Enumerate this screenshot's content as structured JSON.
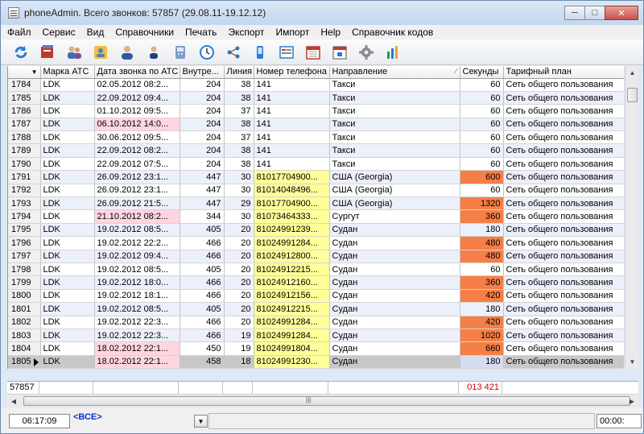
{
  "window": {
    "title": "phoneAdmin. Всего звонков: 57857 (29.08.11-19.12.12)"
  },
  "menu": [
    "Файл",
    "Сервис",
    "Вид",
    "Справочники",
    "Печать",
    "Экспорт",
    "Импорт",
    "Help",
    "Справочник кодов"
  ],
  "toolbar": [
    "refresh-icon",
    "stack-icon",
    "users-icon",
    "contacts-icon",
    "user-icon",
    "person-icon",
    "phone-icon",
    "clock-icon",
    "network-icon",
    "mobile-icon",
    "form-icon",
    "calendar-month-icon",
    "calendar-day-icon",
    "gear-icon",
    "chart-icon"
  ],
  "columns": [
    "",
    "Марка АТС",
    "Дата звонка по АТС",
    "Внутре...",
    "Линия",
    "Номер телефона",
    "Направление",
    "Секунды",
    "Тарифный план"
  ],
  "rows": [
    {
      "id": "1784",
      "ats": "LDK",
      "date": "02.05.2012 08:2...",
      "ext": "204",
      "line": "38",
      "phone": "141",
      "dir": "Такси",
      "sec": "60",
      "plan": "Сеть общего пользования"
    },
    {
      "id": "1785",
      "ats": "LDK",
      "date": "22.09.2012 09:4...",
      "ext": "204",
      "line": "38",
      "phone": "141",
      "dir": "Такси",
      "sec": "60",
      "plan": "Сеть общего пользования"
    },
    {
      "id": "1786",
      "ats": "LDK",
      "date": "01.10.2012 09:5...",
      "ext": "204",
      "line": "37",
      "phone": "141",
      "dir": "Такси",
      "sec": "60",
      "plan": "Сеть общего пользования"
    },
    {
      "id": "1787",
      "ats": "LDK",
      "date": "06.10.2012 14:0...",
      "ext": "204",
      "line": "38",
      "phone": "141",
      "dir": "Такси",
      "sec": "60",
      "plan": "Сеть общего пользования",
      "date_hl": "pink"
    },
    {
      "id": "1788",
      "ats": "LDK",
      "date": "30.06.2012 09:5...",
      "ext": "204",
      "line": "37",
      "phone": "141",
      "dir": "Такси",
      "sec": "60",
      "plan": "Сеть общего пользования"
    },
    {
      "id": "1789",
      "ats": "LDK",
      "date": "22.09.2012 08:2...",
      "ext": "204",
      "line": "38",
      "phone": "141",
      "dir": "Такси",
      "sec": "60",
      "plan": "Сеть общего пользования"
    },
    {
      "id": "1790",
      "ats": "LDK",
      "date": "22.09.2012 07:5...",
      "ext": "204",
      "line": "38",
      "phone": "141",
      "dir": "Такси",
      "sec": "60",
      "plan": "Сеть общего пользования"
    },
    {
      "id": "1791",
      "ats": "LDK",
      "date": "26.09.2012 23:1...",
      "ext": "447",
      "line": "30",
      "phone": "81017704900...",
      "dir": "США (Georgia)",
      "sec": "600",
      "plan": "Сеть общего пользования",
      "phone_hl": "yellow",
      "sec_hl": "orange"
    },
    {
      "id": "1792",
      "ats": "LDK",
      "date": "26.09.2012 23:1...",
      "ext": "447",
      "line": "30",
      "phone": "81014048496...",
      "dir": "США (Georgia)",
      "sec": "60",
      "plan": "Сеть общего пользования",
      "phone_hl": "yellow"
    },
    {
      "id": "1793",
      "ats": "LDK",
      "date": "26.09.2012 21:5...",
      "ext": "447",
      "line": "29",
      "phone": "81017704900...",
      "dir": "США (Georgia)",
      "sec": "1320",
      "plan": "Сеть общего пользования",
      "phone_hl": "yellow",
      "sec_hl": "orange"
    },
    {
      "id": "1794",
      "ats": "LDK",
      "date": "21.10.2012 08:2...",
      "ext": "344",
      "line": "30",
      "phone": "81073464333...",
      "dir": "Сургут",
      "sec": "360",
      "plan": "Сеть общего пользования",
      "date_hl": "pink",
      "phone_hl": "yellow",
      "sec_hl": "orange"
    },
    {
      "id": "1795",
      "ats": "LDK",
      "date": "19.02.2012 08:5...",
      "ext": "405",
      "line": "20",
      "phone": "81024991239...",
      "dir": "Судан",
      "sec": "180",
      "plan": "Сеть общего пользования",
      "phone_hl": "yellow"
    },
    {
      "id": "1796",
      "ats": "LDK",
      "date": "19.02.2012 22:2...",
      "ext": "466",
      "line": "20",
      "phone": "81024991284...",
      "dir": "Судан",
      "sec": "480",
      "plan": "Сеть общего пользования",
      "phone_hl": "yellow",
      "sec_hl": "orange"
    },
    {
      "id": "1797",
      "ats": "LDK",
      "date": "19.02.2012 09:4...",
      "ext": "466",
      "line": "20",
      "phone": "81024912800...",
      "dir": "Судан",
      "sec": "480",
      "plan": "Сеть общего пользования",
      "phone_hl": "yellow",
      "sec_hl": "orange"
    },
    {
      "id": "1798",
      "ats": "LDK",
      "date": "19.02.2012 08:5...",
      "ext": "405",
      "line": "20",
      "phone": "81024912215...",
      "dir": "Судан",
      "sec": "60",
      "plan": "Сеть общего пользования",
      "phone_hl": "yellow"
    },
    {
      "id": "1799",
      "ats": "LDK",
      "date": "19.02.2012 18:0...",
      "ext": "466",
      "line": "20",
      "phone": "81024912160...",
      "dir": "Судан",
      "sec": "360",
      "plan": "Сеть общего пользования",
      "phone_hl": "yellow",
      "sec_hl": "orange"
    },
    {
      "id": "1800",
      "ats": "LDK",
      "date": "19.02.2012 18:1...",
      "ext": "466",
      "line": "20",
      "phone": "81024912156...",
      "dir": "Судан",
      "sec": "420",
      "plan": "Сеть общего пользования",
      "phone_hl": "yellow",
      "sec_hl": "orange"
    },
    {
      "id": "1801",
      "ats": "LDK",
      "date": "19.02.2012 08:5...",
      "ext": "405",
      "line": "20",
      "phone": "81024912215...",
      "dir": "Судан",
      "sec": "180",
      "plan": "Сеть общего пользования",
      "phone_hl": "yellow"
    },
    {
      "id": "1802",
      "ats": "LDK",
      "date": "19.02.2012 22:3...",
      "ext": "466",
      "line": "20",
      "phone": "81024991284...",
      "dir": "Судан",
      "sec": "420",
      "plan": "Сеть общего пользования",
      "phone_hl": "yellow",
      "sec_hl": "orange"
    },
    {
      "id": "1803",
      "ats": "LDK",
      "date": "19.02.2012 22:3...",
      "ext": "466",
      "line": "19",
      "phone": "81024991284...",
      "dir": "Судан",
      "sec": "1020",
      "plan": "Сеть общего пользования",
      "phone_hl": "yellow",
      "sec_hl": "orange"
    },
    {
      "id": "1804",
      "ats": "LDK",
      "date": "18.02.2012 22:1...",
      "ext": "450",
      "line": "19",
      "phone": "81024991804...",
      "dir": "Судан",
      "sec": "660",
      "plan": "Сеть общего пользования",
      "date_hl": "pink",
      "phone_hl": "yellow",
      "sec_hl": "orange"
    },
    {
      "id": "1805",
      "ats": "LDK",
      "date": "18.02.2012 22:1...",
      "ext": "458",
      "line": "18",
      "phone": "81024991230...",
      "dir": "Судан",
      "sec": "180",
      "plan": "Сеть общего пользования",
      "date_hl": "pink",
      "phone_hl": "yellow",
      "sec_hl": "blue",
      "selected": true
    }
  ],
  "footer": {
    "count": "57857",
    "seconds_total": "013 421"
  },
  "status": {
    "time": "06:17:09",
    "filter": "<ВСЕ>",
    "timer": "00:00:"
  },
  "colors": {
    "yellow": "#ffff99",
    "pink": "#ffd6df",
    "orange": "#f57f46",
    "alt_row": "#ecf0fb",
    "seconds_total": "#cc0000",
    "filter": "#0033cc"
  }
}
